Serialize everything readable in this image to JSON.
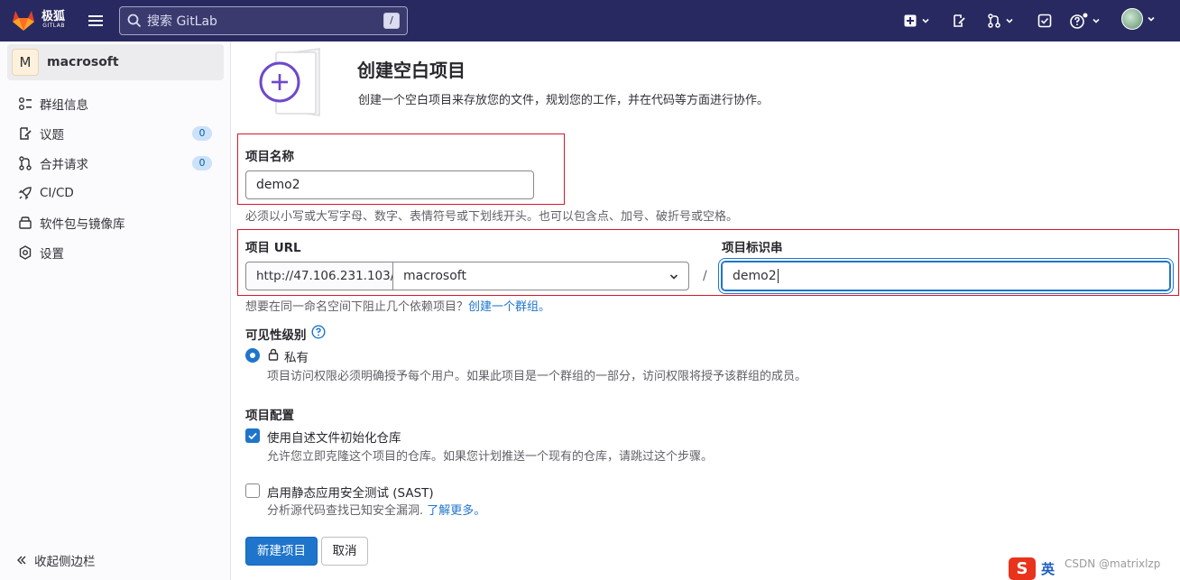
{
  "topbar": {
    "brand": "极狐",
    "brand_sub": "GITLAB",
    "search_placeholder": "搜索 GitLab",
    "search_shortcut": "/"
  },
  "sidebar": {
    "context_avatar": "M",
    "context_name": "macrosoft",
    "items": [
      {
        "label": "群组信息",
        "icon": "group-info-icon"
      },
      {
        "label": "议题",
        "icon": "issues-icon",
        "badge": "0"
      },
      {
        "label": "合并请求",
        "icon": "merge-request-icon",
        "badge": "0"
      },
      {
        "label": "CI/CD",
        "icon": "rocket-icon"
      },
      {
        "label": "软件包与镜像库",
        "icon": "package-icon"
      },
      {
        "label": "设置",
        "icon": "settings-icon"
      }
    ],
    "collapse_label": "收起侧边栏"
  },
  "header": {
    "title": "创建空白项目",
    "description": "创建一个空白项目来存放您的文件，规划您的工作，并在代码等方面进行协作。"
  },
  "form": {
    "project_name_label": "项目名称",
    "project_name_value": "demo2",
    "project_name_hint": "必须以小写或大写字母、数字、表情符号或下划线开头。也可以包含点、加号、破折号或空格。",
    "project_url_label": "项目 URL",
    "url_prefix": "http://47.106.231.103/",
    "namespace_value": "macrosoft",
    "url_separator": "/",
    "slug_label": "项目标识串",
    "slug_value": "demo2",
    "group_hint": "想要在同一命名空间下阻止几个依赖项目？",
    "group_link": "创建一个群组。",
    "visibility_label": "可见性级别",
    "visibility_private": "私有",
    "visibility_private_desc": "项目访问权限必须明确授予每个用户。如果此项目是一个群组的一部分，访问权限将授予该群组的成员。",
    "config_label": "项目配置",
    "readme_label": "使用自述文件初始化仓库",
    "readme_desc": "允许您立即克隆这个项目的仓库。如果您计划推送一个现有的仓库，请跳过这个步骤。",
    "sast_label": "启用静态应用安全测试 (SAST)",
    "sast_desc": "分析源代码查找已知安全漏洞.",
    "sast_link": "了解更多。",
    "submit_label": "新建项目",
    "cancel_label": "取消"
  },
  "overlay": {
    "ime_logo": "S",
    "ime_lang": "英",
    "watermark": "CSDN @matrixlzp"
  },
  "colors": {
    "topbar_bg": "#292961",
    "primary": "#1f75cb",
    "highlight_border": "#d8182c"
  }
}
